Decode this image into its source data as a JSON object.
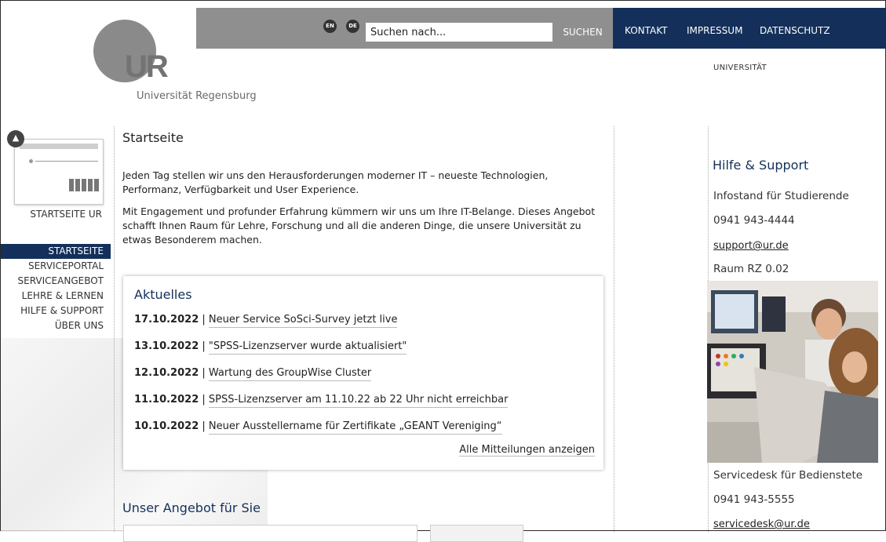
{
  "logo": {
    "letters": "UR",
    "name": "Universität Regensburg"
  },
  "top": {
    "lang_en": "EN",
    "lang_de": "DE",
    "search_placeholder": "Suchen nach...",
    "search_button": "SUCHEN",
    "nav": [
      "KONTAKT",
      "IMPRESSUM",
      "DATENSCHUTZ"
    ],
    "universitaet": "UNIVERSITÄT"
  },
  "sidebar": {
    "home_link": "STARTSEITE UR",
    "items": [
      "STARTSEITE",
      "SERVICEPORTAL",
      "SERVICEANGEBOT",
      "LEHRE & LERNEN",
      "HILFE & SUPPORT",
      "ÜBER UNS"
    ],
    "active_index": 0
  },
  "main": {
    "title": "Startseite",
    "intro_1": "Jeden Tag stellen wir uns den Herausforderungen moderner IT – neueste Technologien, Performanz, Verfügbarkeit und User Experience.",
    "intro_2": "Mit Engagement und profunder Erfahrung kümmern wir uns um Ihre IT-Belange. Dieses Angebot schafft Ihnen Raum für Lehre, Forschung und all die anderen Dinge, die unsere Universität zu etwas Besonderem machen.",
    "news_title": "Aktuelles",
    "news": [
      {
        "date": "17.10.2022",
        "text": "Neuer Service SoSci-Survey jetzt live"
      },
      {
        "date": "13.10.2022",
        "text": "\"SPSS-Lizenzserver wurde aktualisiert\""
      },
      {
        "date": "12.10.2022",
        "text": "Wartung des GroupWise Cluster"
      },
      {
        "date": "11.10.2022",
        "text": "SPSS-Lizenzserver am 11.10.22 ab 22 Uhr nicht erreichbar"
      },
      {
        "date": "10.10.2022",
        "text": "Neuer Ausstellername für Zertifikate „GEANT Vereniging“"
      }
    ],
    "all_news": "Alle Mitteilungen anzeigen",
    "offer_title": "Unser Angebot für Sie"
  },
  "right": {
    "title": "Hilfe & Support",
    "students_label": "Infostand für Studierende",
    "students_phone": "0941 943-4444",
    "students_email": "support@ur.de",
    "room": "Raum RZ 0.02",
    "staff_label": "Servicedesk für Bedienstete",
    "staff_phone": "0941 943-5555",
    "staff_email": "servicedesk@ur.de"
  }
}
